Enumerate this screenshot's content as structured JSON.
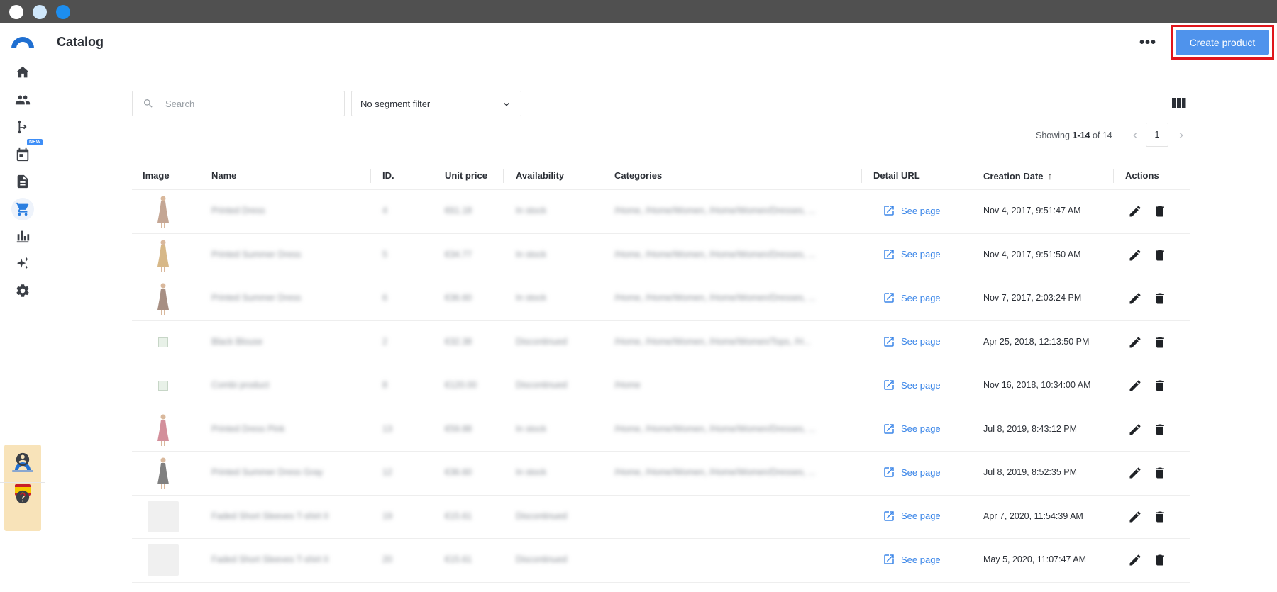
{
  "window": {
    "dots": [
      "close",
      "minimize",
      "maximize"
    ]
  },
  "sidebar": {
    "items": [
      {
        "name": "home-icon"
      },
      {
        "name": "users-icon"
      },
      {
        "name": "flow-icon"
      },
      {
        "name": "calendar-icon",
        "badge": "NEW"
      },
      {
        "name": "document-icon"
      },
      {
        "name": "cart-icon",
        "active": true
      },
      {
        "name": "bar-chart-icon"
      },
      {
        "name": "sparkle-icon"
      },
      {
        "name": "gear-icon"
      }
    ],
    "bottom": [
      "account-icon",
      "help-icon"
    ]
  },
  "header": {
    "title": "Catalog",
    "more_label": "•••",
    "create_label": "Create product"
  },
  "toolbar": {
    "search_placeholder": "Search",
    "segment_value": "No segment filter"
  },
  "pagination": {
    "prefix": "Showing ",
    "range": "1-14",
    "suffix": " of 14",
    "page": "1"
  },
  "table": {
    "columns": [
      "Image",
      "Name",
      "ID.",
      "Unit price",
      "Availability",
      "Categories",
      "Detail URL",
      "Creation Date",
      "Actions"
    ],
    "sort_indicator": "↑",
    "link_label": "See page",
    "rows": [
      {
        "image": "dress-1",
        "name": "Printed Dress",
        "id": "4",
        "price": "€61.18",
        "availability": "In stock",
        "categories": "/Home, /Home/Women, /Home/Women/Dresses, ...",
        "created": "Nov 4, 2017, 9:51:47 AM"
      },
      {
        "image": "dress-2",
        "name": "Printed Summer Dress",
        "id": "5",
        "price": "€34.77",
        "availability": "In stock",
        "categories": "/Home, /Home/Women, /Home/Women/Dresses, ...",
        "created": "Nov 4, 2017, 9:51:50 AM"
      },
      {
        "image": "dress-3",
        "name": "Printed Summer Dress",
        "id": "6",
        "price": "€36.60",
        "availability": "In stock",
        "categories": "/Home, /Home/Women, /Home/Women/Dresses, ...",
        "created": "Nov 7, 2017, 2:03:24 PM"
      },
      {
        "image": "broken",
        "name": "Black Blouse",
        "id": "2",
        "price": "€32.38",
        "availability": "Discontinued",
        "categories": "/Home, /Home/Women, /Home/Women/Tops, /H...",
        "created": "Apr 25, 2018, 12:13:50 PM"
      },
      {
        "image": "broken",
        "name": "Combi product",
        "id": "8",
        "price": "€120.00",
        "availability": "Discontinued",
        "categories": "/Home",
        "created": "Nov 16, 2018, 10:34:00 AM"
      },
      {
        "image": "dress-pink",
        "name": "Printed Dress Pink",
        "id": "13",
        "price": "€59.88",
        "availability": "In stock",
        "categories": "/Home, /Home/Women, /Home/Women/Dresses, ...",
        "created": "Jul 8, 2019, 8:43:12 PM"
      },
      {
        "image": "dress-4",
        "name": "Printed Summer Dress Gray",
        "id": "12",
        "price": "€36.60",
        "availability": "In stock",
        "categories": "/Home, /Home/Women, /Home/Women/Dresses, ...",
        "created": "Jul 8, 2019, 8:52:35 PM"
      },
      {
        "image": "placeholder",
        "name": "Faded Short Sleeves T-shirt II",
        "id": "19",
        "price": "€15.61",
        "availability": "Discontinued",
        "categories": "",
        "created": "Apr 7, 2020, 11:54:39 AM"
      },
      {
        "image": "placeholder",
        "name": "Faded Short Sleeves T-shirt II",
        "id": "20",
        "price": "€15.61",
        "availability": "Discontinued",
        "categories": "",
        "created": "May 5, 2020, 11:07:47 AM"
      }
    ]
  },
  "colors": {
    "accent": "#4f93ec",
    "link": "#3b86e8",
    "highlight": "#e0151b",
    "titlebar": "#505050"
  }
}
